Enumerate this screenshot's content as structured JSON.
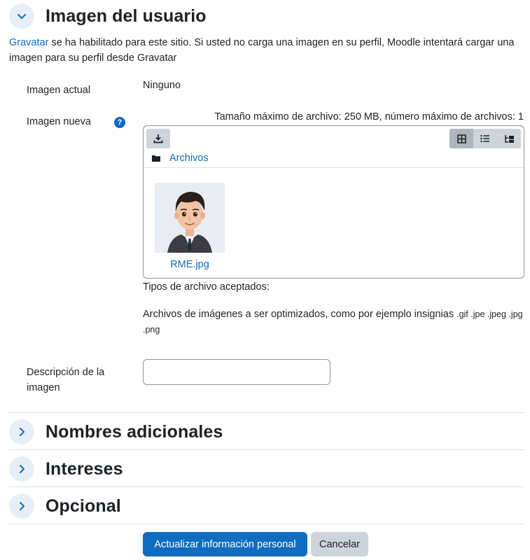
{
  "sections": {
    "user_picture": {
      "title": "Imagen del usuario",
      "expanded": true
    },
    "additional_names": {
      "title": "Nombres adicionales",
      "expanded": false
    },
    "interests": {
      "title": "Intereses",
      "expanded": false
    },
    "optional": {
      "title": "Opcional",
      "expanded": false
    }
  },
  "intro": {
    "link_text": "Gravatar",
    "text": " se ha habilitado para este sitio. Si usted no carga una imagen en su perfil, Moodle intentará cargar una imagen para su perfil desde Gravatar"
  },
  "current_picture": {
    "label": "Imagen actual",
    "value": "Ninguno"
  },
  "new_picture": {
    "label": "Imagen nueva",
    "help_icon": "question-circle-icon",
    "max_size_text": "Tamaño máximo de archivo: 250 MB, número máximo de archivos: 1",
    "breadcrumb": "Archivos",
    "file_name": "RME.jpg",
    "accepted_types_label": "Tipos de archivo aceptados:",
    "accepted_types_desc": "Archivos de imágenes a ser optimizados, como por ejemplo insignias ",
    "accepted_types_ext": ".gif .jpe .jpeg .jpg .png",
    "view_modes": [
      "grid-view-icon",
      "list-view-icon",
      "tree-view-icon"
    ],
    "active_view": "grid-view-icon"
  },
  "image_description": {
    "label": "Descripción de la imagen",
    "value": ""
  },
  "buttons": {
    "submit": "Actualizar información personal",
    "cancel": "Cancelar"
  },
  "colors": {
    "accent": "#0f6cbf",
    "chevron_bg": "#e7eef8",
    "secondary_btn": "#ced4da",
    "text": "#1d2125"
  }
}
